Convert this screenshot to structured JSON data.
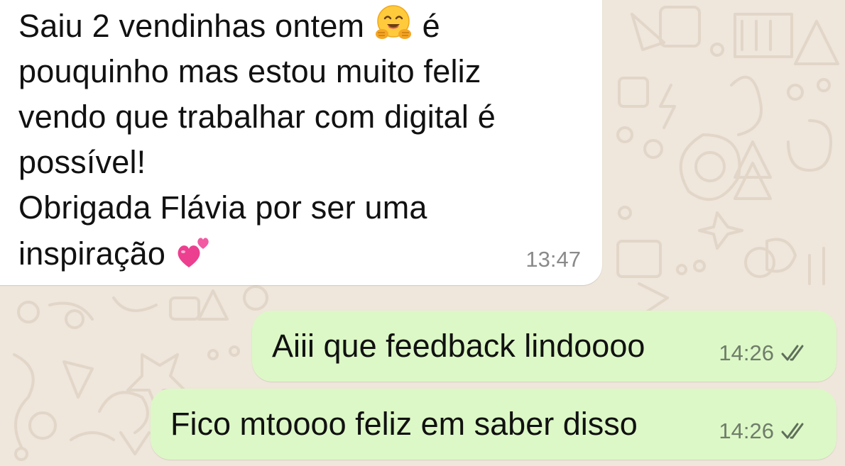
{
  "chat": {
    "incoming": {
      "text": "Saiu 2 vendinhas ontem",
      "after_emoji_1": "é\npouquinho mas estou muito feliz\nvendo que trabalhar com digital é\npossível!\nObrigada Flávia por ser uma\ninspiração",
      "emoji_1": "hugging-face",
      "emoji_2": "two-hearts",
      "time": "13:47"
    },
    "outgoing": [
      {
        "text": "Aiii que feedback lindoooo",
        "time": "14:26",
        "status": "read-double-check"
      },
      {
        "text": "Fico mtoooo feliz em saber disso",
        "time": "14:26",
        "status": "read-double-check"
      }
    ]
  },
  "colors": {
    "background": "#efe6dc",
    "incoming_bubble": "#ffffff",
    "outgoing_bubble": "#dcf8c6",
    "timestamp": "#8a8a8a"
  }
}
